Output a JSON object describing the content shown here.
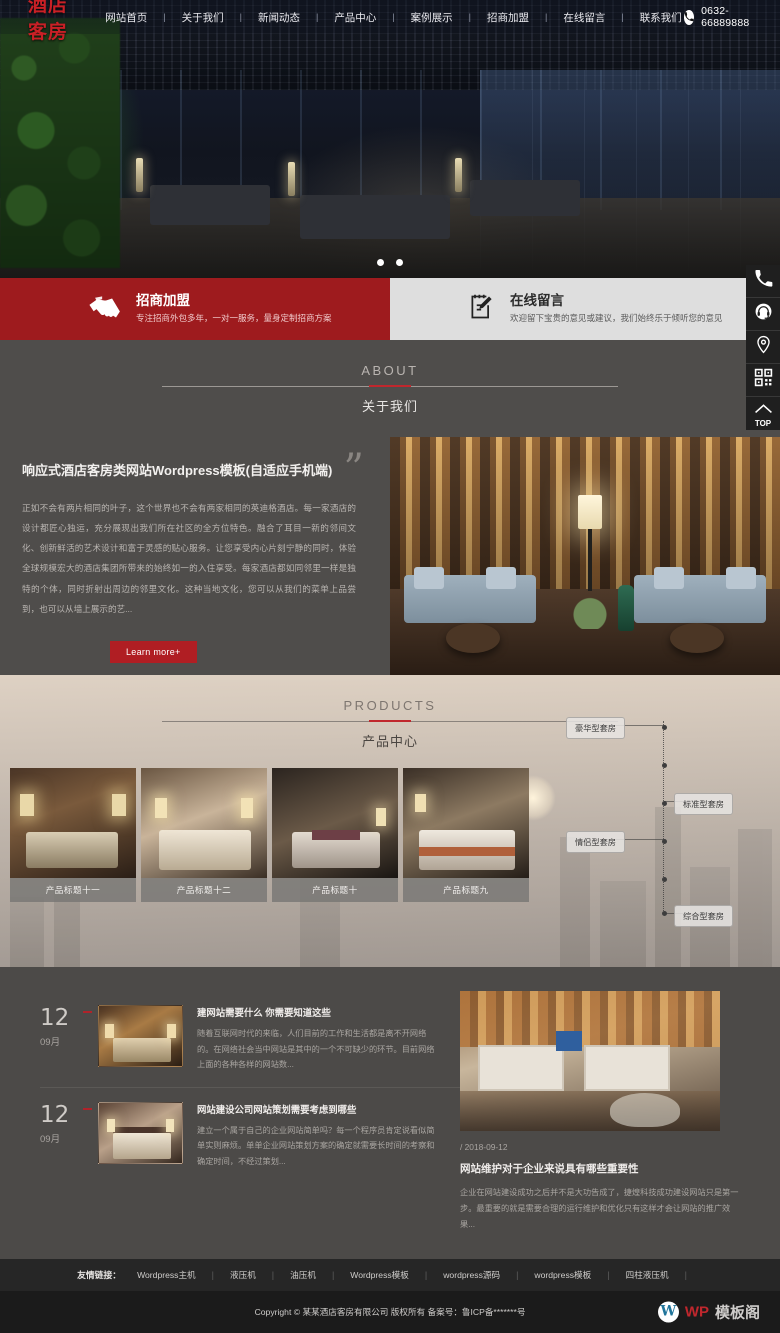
{
  "header": {
    "logo_text": "酒店客房",
    "nav": [
      {
        "label": "网站首页"
      },
      {
        "label": "关于我们"
      },
      {
        "label": "新闻动态"
      },
      {
        "label": "产品中心"
      },
      {
        "label": "案例展示"
      },
      {
        "label": "招商加盟"
      },
      {
        "label": "在线留言"
      },
      {
        "label": "联系我们"
      }
    ],
    "separator": "|",
    "phone_icon": "phone-icon",
    "phone": "0632-66889888"
  },
  "hero": {
    "slides_total": 2,
    "active_slide": 1
  },
  "quickbar": {
    "left": {
      "icon": "handshake-icon",
      "title": "招商加盟",
      "subtitle": "专注招商外包多年，一对一服务，量身定制招商方案",
      "bg": "#9e1b1e"
    },
    "right": {
      "icon": "message-pen-icon",
      "title": "在线留言",
      "subtitle": "欢迎留下宝贵的意见或建议，我们始终乐于倾听您的意见",
      "bg": "#dedede"
    }
  },
  "about": {
    "title_en": "ABOUT",
    "title_cn": "关于我们",
    "heading": "响应式酒店客房类网站Wordpress模板(自适应手机端)",
    "paragraph": "正如不会有两片相同的叶子，这个世界也不会有两家相同的英迪格酒店。每一家酒店的设计都匠心独运，充分展现出我们所在社区的全方位特色。融合了耳目一新的邻间文化、创新鲜活的艺术设计和富于灵感的贴心服务。让您享受内心片刻宁静的同时，体验全球规模宏大的酒店集团所带来的始终如一的入住享受。每家酒店都如同邻里一样是独特的个体，同时折射出周边的邻里文化。这种当地文化，您可以从我们的菜单上品尝到，也可以从墙上展示的艺...",
    "button": "Learn more+"
  },
  "products": {
    "title_en": "PRODUCTS",
    "title_cn": "产品中心",
    "cards": [
      {
        "caption": "产品标题十一"
      },
      {
        "caption": "产品标题十二"
      },
      {
        "caption": "产品标题十"
      },
      {
        "caption": "产品标题九"
      }
    ],
    "timeline_labels": [
      {
        "label": "豪华型套房",
        "side": "left"
      },
      {
        "label": "标准型套房",
        "side": "right"
      },
      {
        "label": "情侣型套房",
        "side": "left"
      },
      {
        "label": "综合型套房",
        "side": "right"
      }
    ]
  },
  "news": {
    "items": [
      {
        "day": "12",
        "month": "09月",
        "title": "建网站需要什么 你需要知道这些",
        "desc": "随着互联网时代的来临，人们目前的工作和生活都是离不开网络的。在网络社会当中网站是其中的一个不可缺少的环节。目前网络上面的各种各样的网站数..."
      },
      {
        "day": "12",
        "month": "09月",
        "title": "网站建设公司网站策划需要考虑到哪些",
        "desc": "建立一个属于自己的企业网站简单吗？每一个程序员肯定说看似简单实则麻烦。单单企业网站策划方案的确定就需要长时间的考察和确定时间，不经过策划..."
      }
    ],
    "featured": {
      "date": "/ 2018-09-12",
      "title": "网站维护对于企业来说具有哪些重要性",
      "desc": "企业在网站建设成功之后并不是大功告成了，捷煌科技成功建设网站只是第一步。最重要的就是需要合理的运行维护和优化只有这样才会让网站的推广效果..."
    }
  },
  "footer": {
    "friendly_label": "友情链接：",
    "links": [
      {
        "label": "Wordpress主机"
      },
      {
        "label": "液压机"
      },
      {
        "label": "油压机"
      },
      {
        "label": "Wordpress模板"
      },
      {
        "label": "wordpress源码"
      },
      {
        "label": "wordpress模板"
      },
      {
        "label": "四柱液压机"
      }
    ],
    "separator": "|",
    "copyright": "Copyright © 某某酒店客房有限公司 版权所有 备案号：鲁ICP备*******号",
    "brand": {
      "icon": "wordpress-icon",
      "part1": "WP",
      "part2": "模板阁"
    }
  },
  "sidebar": {
    "items": [
      {
        "icon": "phone-icon",
        "name": "phone"
      },
      {
        "icon": "headset-icon",
        "name": "service"
      },
      {
        "icon": "location-pin-icon",
        "name": "map"
      },
      {
        "icon": "qrcode-icon",
        "name": "qrcode"
      },
      {
        "icon": "arrow-up-icon",
        "label": "TOP",
        "name": "back-to-top"
      }
    ]
  },
  "theme": {
    "accent_red": "#b01e23",
    "dark_red": "#9e1b1e",
    "panel_gray": "#4f4d4b",
    "footer_dark": "#1b1b1b"
  }
}
